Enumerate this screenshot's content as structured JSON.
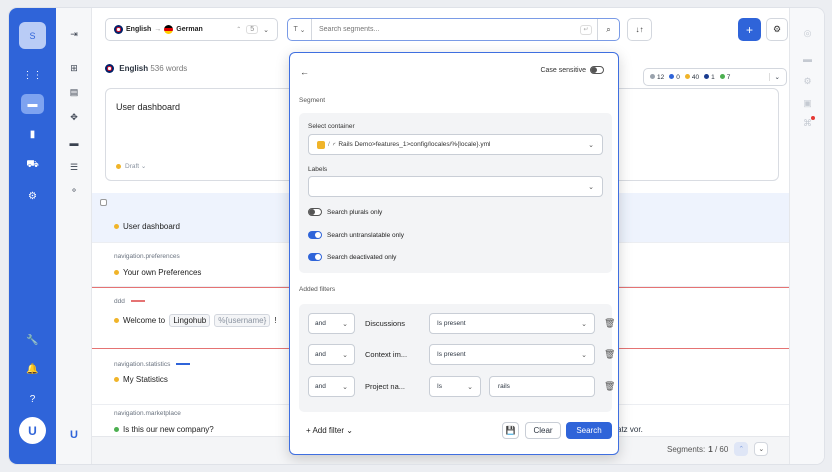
{
  "sidebar": {
    "avatar": "S",
    "logo": "U",
    "items": [
      {
        "icon": "grid-icon",
        "glyph": "⋮⋮"
      },
      {
        "icon": "chat-icon",
        "glyph": "▬",
        "active": true
      },
      {
        "icon": "bar-chart-icon",
        "glyph": "▮"
      },
      {
        "icon": "cart-icon",
        "glyph": "⛟"
      },
      {
        "icon": "gear-icon",
        "glyph": "⚙"
      },
      {
        "icon": "wrench-icon",
        "glyph": "🔧"
      },
      {
        "icon": "bell-icon",
        "glyph": "🔔"
      },
      {
        "icon": "help-icon",
        "glyph": "?"
      }
    ]
  },
  "subbar": {
    "collapse_glyph": "⇥",
    "items": [
      "⊞",
      "▤",
      "✥",
      "▬",
      "☰",
      "⚬"
    ],
    "logo": "U"
  },
  "top": {
    "source_lang": "English",
    "target_lang": "German",
    "arrow": "→",
    "count_badge": "5",
    "type_selector": "T",
    "search_placeholder": "Search segments...",
    "enter_glyph": "↵",
    "search_glyph": "⌕",
    "sort_glyph": "↓↑",
    "add_glyph": "+",
    "settings_glyph": "⚙"
  },
  "source": {
    "header_lang": "English",
    "header_count": "536 words",
    "text": "User dashboard",
    "status": "Draft"
  },
  "stats": [
    {
      "color": "#9aa3ad",
      "value": "12"
    },
    {
      "color": "#2f64d9",
      "value": "0"
    },
    {
      "color": "#f0b429",
      "value": "40"
    },
    {
      "color": "#1a3c8f",
      "value": "1"
    },
    {
      "color": "#4caf50",
      "value": "7"
    }
  ],
  "rows": [
    {
      "key": "",
      "text": "User dashboard"
    },
    {
      "key": "navigation.preferences",
      "text": "Your own Preferences"
    },
    {
      "key": "ddd",
      "text_pre": "Welcome to",
      "chip": "Lingohub",
      "var": "%{username}",
      "text_post": "!"
    },
    {
      "key": "navigation.statistics",
      "text": "My Statistics"
    },
    {
      "key": "navigation.marketplace",
      "text": "Is this our new company?",
      "trail": "atz vor."
    }
  ],
  "pagination": {
    "label": "Segments:",
    "current": "1",
    "total": "/ 60"
  },
  "panel": {
    "back": "←",
    "case_sensitive": "Case sensitive",
    "segment_label": "Segment",
    "container_label": "Select container",
    "container_value": "Rails Demo>features_1>config/locales/%{locale}.yml",
    "labels_label": "Labels",
    "toggles": [
      {
        "label": "Search plurals only",
        "on": false
      },
      {
        "label": "Search untranslatable only",
        "on": true
      },
      {
        "label": "Search deactivated only",
        "on": true
      }
    ],
    "added_filters": "Added filters",
    "filters": [
      {
        "and": "and",
        "name": "Discussions",
        "op": "Is present",
        "value": ""
      },
      {
        "and": "and",
        "name": "Context im...",
        "op": "Is present",
        "value": ""
      },
      {
        "and": "and",
        "name": "Project na...",
        "op": "Is",
        "value": "rails"
      }
    ],
    "add_filter": "+ Add filter",
    "clear": "Clear",
    "search": "Search"
  }
}
